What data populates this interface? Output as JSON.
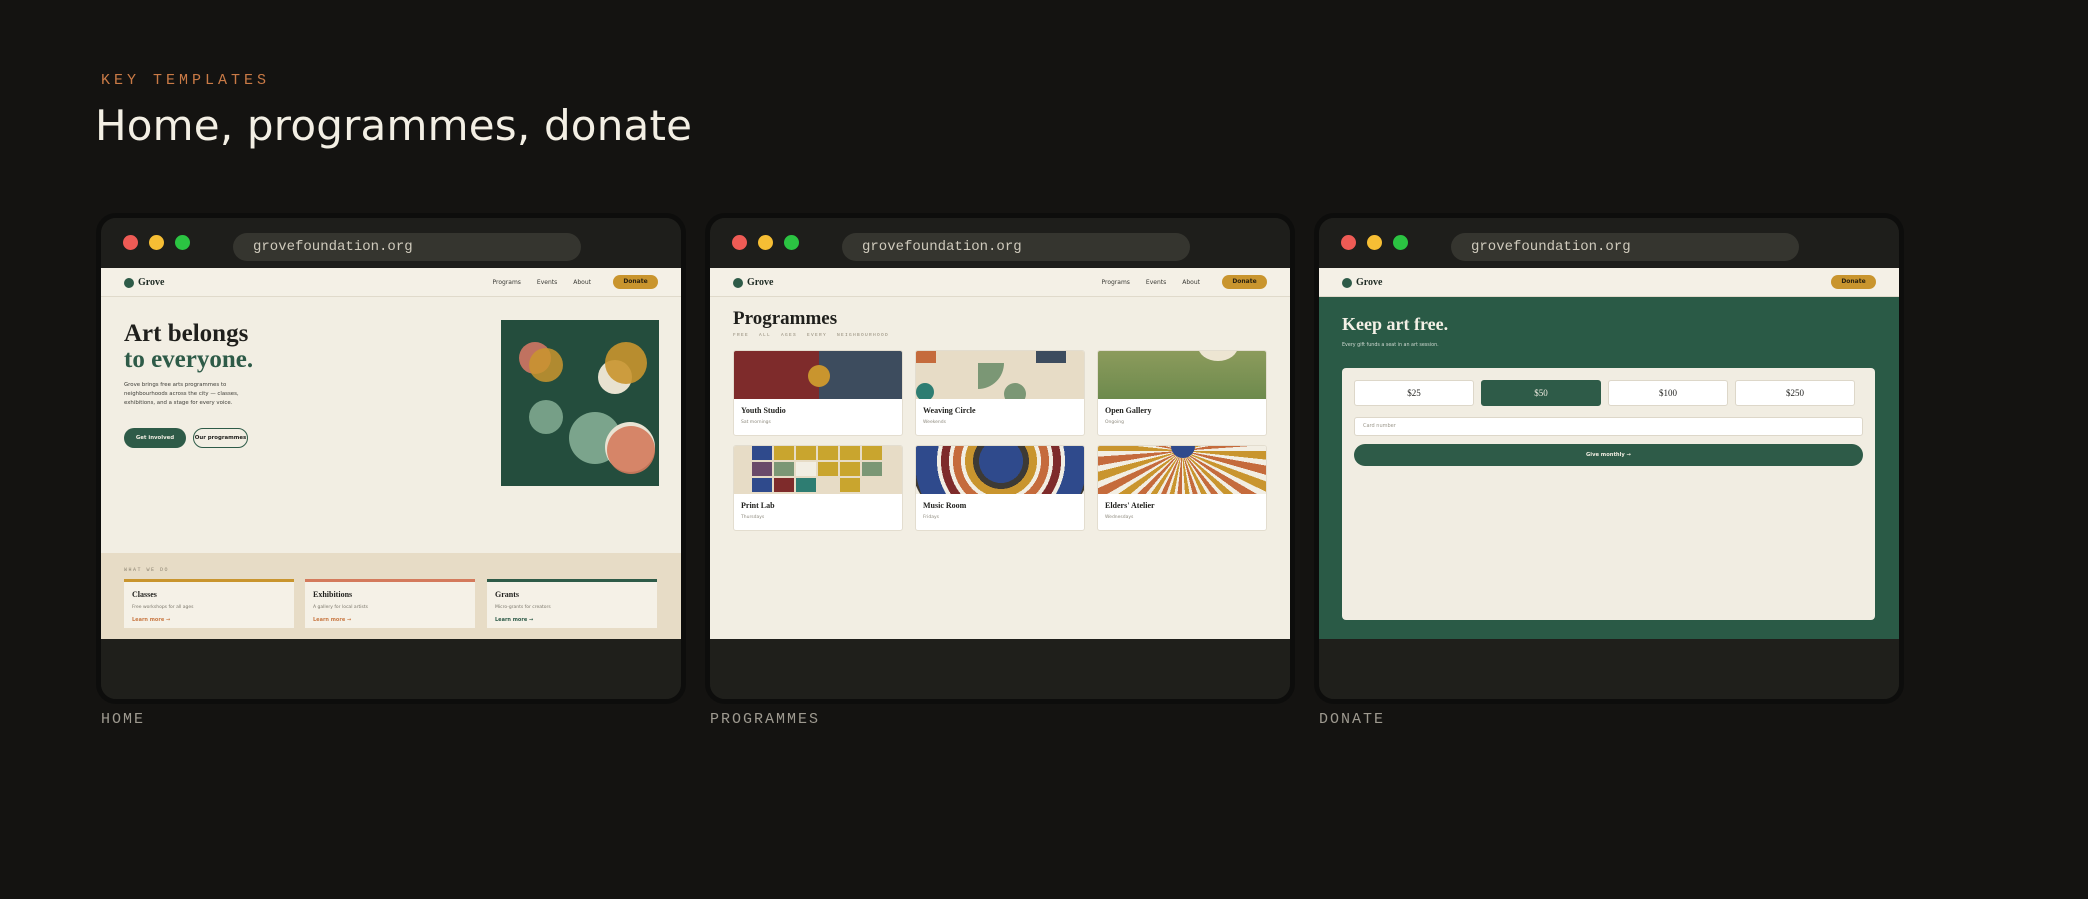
{
  "eyebrow": "KEY TEMPLATES",
  "headline": "Home, programmes, donate",
  "url": "grovefoundation.org",
  "brand": "Grove",
  "colors": {
    "bg": "#141311",
    "green": "#2e5b48",
    "gold": "#c9952e",
    "rust": "#c97a46",
    "cream": "#f2eee3"
  },
  "home": {
    "caption": "HOME",
    "nav": [
      "Programs",
      "Events",
      "About"
    ],
    "donate_btn": "Donate",
    "title_line1": "Art belongs",
    "title_line2": "to everyone.",
    "intro": "Grove brings free arts programmes to neighbourhoods across the city — classes, exhibitions, and a stage for every voice.",
    "cta_primary": "Get involved",
    "cta_secondary": "Our programmes",
    "what_label": "WHAT WE DO",
    "cards": [
      {
        "title": "Classes",
        "sub": "Free workshops for all ages",
        "link": "Learn more →",
        "color": "#c9952e"
      },
      {
        "title": "Exhibitions",
        "sub": "A gallery for local artists",
        "link": "Learn more →",
        "color": "#d47a5c"
      },
      {
        "title": "Grants",
        "sub": "Micro-grants for creators",
        "link": "Learn more →",
        "color": "#2e5b48"
      }
    ]
  },
  "programmes": {
    "caption": "PROGRAMMES",
    "nav": [
      "Programs",
      "Events",
      "About"
    ],
    "donate_btn": "Donate",
    "title": "Programmes",
    "filters": "FREE  ALL AGES  EVERY NEIGHBOURHOOD",
    "items": [
      {
        "title": "Youth Studio",
        "sub": "Sat mornings"
      },
      {
        "title": "Weaving Circle",
        "sub": "Weekends"
      },
      {
        "title": "Open Gallery",
        "sub": "Ongoing"
      },
      {
        "title": "Print Lab",
        "sub": "Thursdays"
      },
      {
        "title": "Music Room",
        "sub": "Fridays"
      },
      {
        "title": "Elders' Atelier",
        "sub": "Wednesdays"
      }
    ]
  },
  "donate": {
    "caption": "DONATE",
    "donate_btn": "Donate",
    "title": "Keep art free.",
    "sub": "Every gift funds a seat in an art session.",
    "amounts": [
      "$25",
      "$50",
      "$100",
      "$250"
    ],
    "selected": "$50",
    "card_placeholder": "Card number",
    "give_btn": "Give monthly →"
  }
}
